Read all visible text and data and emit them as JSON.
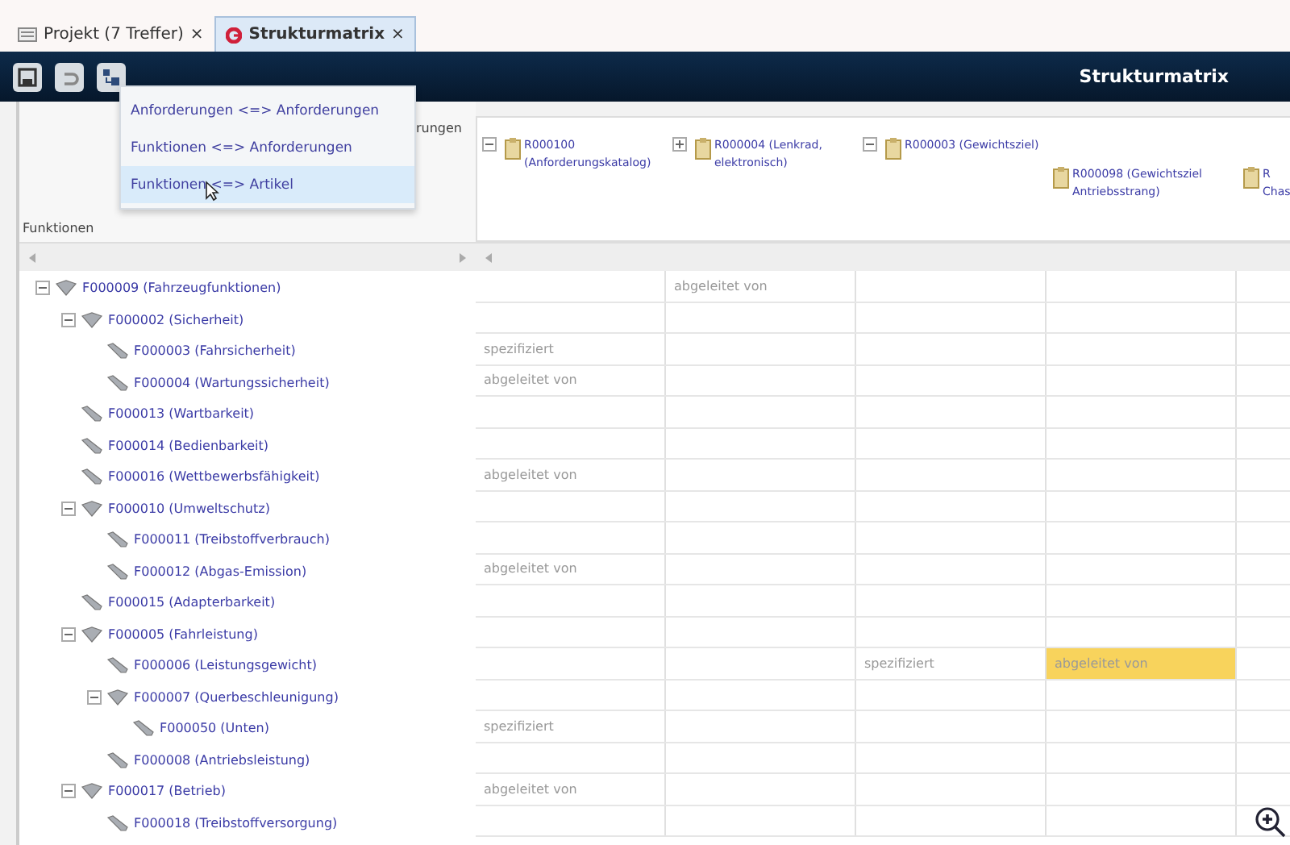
{
  "tabs": [
    {
      "label": "Projekt (7 Treffer)",
      "kind": "list",
      "selected": false,
      "close": "×"
    },
    {
      "label": "Strukturmatrix",
      "kind": "matrix",
      "selected": true,
      "close": "×"
    }
  ],
  "toolbar": {
    "title": "Strukturmatrix"
  },
  "menu": {
    "items": [
      {
        "label": "Anforderungen <=> Anforderungen",
        "selected": false
      },
      {
        "label": "Funktionen <=> Anforderungen",
        "selected": false
      },
      {
        "label": "Funktionen <=> Artikel",
        "selected": true
      }
    ]
  },
  "matrix": {
    "row_header": "Funktionen",
    "column_header": "rungen",
    "columns": [
      {
        "label": "R000100 (Anforderungskatalog)",
        "expanded": true
      },
      {
        "label": "R000004 (Lenkrad, elektronisch)",
        "expanded": false
      },
      {
        "label": "R000003 (Gewichtsziel)",
        "expanded": true,
        "children": [
          {
            "label": "R000098 (Gewichtsziel Antriebsstrang)"
          },
          {
            "label": "R\nChas"
          }
        ]
      }
    ],
    "tree": [
      {
        "label": "F000009 (Fahrzeugfunktionen)",
        "expanded": true,
        "children": [
          {
            "label": "F000002 (Sicherheit)",
            "expanded": true,
            "children": [
              {
                "label": "F000003 (Fahrsicherheit)"
              },
              {
                "label": "F000004 (Wartungssicherheit)"
              }
            ]
          },
          {
            "label": "F000013 (Wartbarkeit)"
          },
          {
            "label": "F000014 (Bedienbarkeit)"
          },
          {
            "label": "F000016 (Wettbewerbsfähigkeit)"
          },
          {
            "label": "F000010 (Umweltschutz)",
            "expanded": true,
            "children": [
              {
                "label": "F000011 (Treibstoffverbrauch)"
              },
              {
                "label": "F000012 (Abgas-Emission)"
              }
            ]
          },
          {
            "label": "F000015 (Adapterbarkeit)"
          },
          {
            "label": "F000005 (Fahrleistung)",
            "expanded": true,
            "children": [
              {
                "label": "F000006 (Leistungsgewicht)"
              },
              {
                "label": "F000007 (Querbeschleunigung)",
                "expanded": true,
                "children": [
                  {
                    "label": "F000050 (Unten)"
                  }
                ]
              },
              {
                "label": "F000008 (Antriebsleistung)"
              }
            ]
          },
          {
            "label": "F000017 (Betrieb)",
            "expanded": true,
            "children": [
              {
                "label": "F000018 (Treibstoffversorgung)"
              }
            ]
          }
        ]
      }
    ],
    "rows": [
      [
        null,
        {
          "text": "abgeleitet von",
          "highlighted": false
        },
        null,
        null,
        null
      ],
      [
        null,
        null,
        null,
        null,
        null
      ],
      [
        {
          "text": "spezifiziert",
          "highlighted": false
        },
        null,
        null,
        null,
        null
      ],
      [
        {
          "text": "abgeleitet von",
          "highlighted": false
        },
        null,
        null,
        null,
        null
      ],
      [
        null,
        null,
        null,
        null,
        null
      ],
      [
        null,
        null,
        null,
        null,
        null
      ],
      [
        {
          "text": "abgeleitet von",
          "highlighted": false
        },
        null,
        null,
        null,
        null
      ],
      [
        null,
        null,
        null,
        null,
        null
      ],
      [
        null,
        null,
        null,
        null,
        null
      ],
      [
        {
          "text": "abgeleitet von",
          "highlighted": false
        },
        null,
        null,
        null,
        null
      ],
      [
        null,
        null,
        null,
        null,
        null
      ],
      [
        null,
        null,
        null,
        null,
        null
      ],
      [
        null,
        null,
        {
          "text": "spezifiziert",
          "highlighted": false
        },
        {
          "text": "abgeleitet von",
          "highlighted": true
        },
        null
      ],
      [
        null,
        null,
        null,
        null,
        null
      ],
      [
        {
          "text": "spezifiziert",
          "highlighted": false
        },
        null,
        null,
        null,
        null
      ],
      [
        null,
        null,
        null,
        null,
        null
      ],
      [
        {
          "text": "abgeleitet von",
          "highlighted": false
        },
        null,
        null,
        null,
        null
      ],
      [
        null,
        null,
        null,
        null,
        null
      ]
    ]
  }
}
